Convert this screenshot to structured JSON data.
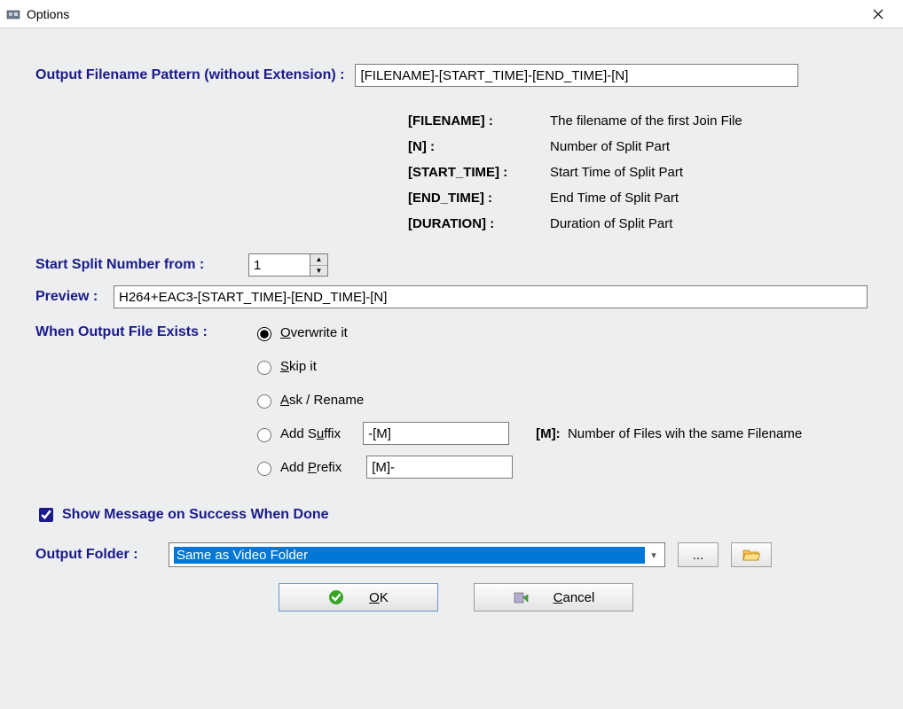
{
  "title": "Options",
  "pattern": {
    "label": "Output Filename Pattern (without Extension) :",
    "value": "[FILENAME]-[START_TIME]-[END_TIME]-[N]"
  },
  "tokens": [
    {
      "key": "[FILENAME] :",
      "desc": "The filename of the first Join File"
    },
    {
      "key": "[N] :",
      "desc": "Number of Split Part"
    },
    {
      "key": "[START_TIME] :",
      "desc": "Start Time of Split Part"
    },
    {
      "key": "[END_TIME] :",
      "desc": "End Time of Split Part"
    },
    {
      "key": "[DURATION] :",
      "desc": "Duration of Split Part"
    }
  ],
  "startNumber": {
    "label": "Start Split Number from :",
    "value": "1"
  },
  "preview": {
    "label": "Preview :",
    "value": "H264+EAC3-[START_TIME]-[END_TIME]-[N]"
  },
  "exists": {
    "label": "When Output File Exists :",
    "overwrite": "Overwrite it",
    "skip": "Skip it",
    "ask": "Ask / Rename",
    "addSuffix": "Add Suffix",
    "addPrefix": "Add Prefix",
    "suffixValue": "-[M]",
    "prefixValue": "[M]-",
    "mKey": "[M]:",
    "mDesc": "Number of Files wih the same Filename"
  },
  "showMessage": {
    "label": "Show Message on Success When Done",
    "checked": true
  },
  "outputFolder": {
    "label": "Output Folder :",
    "value": "Same as Video Folder",
    "browseDots": "..."
  },
  "buttons": {
    "ok": "OK",
    "cancel": "Cancel"
  }
}
